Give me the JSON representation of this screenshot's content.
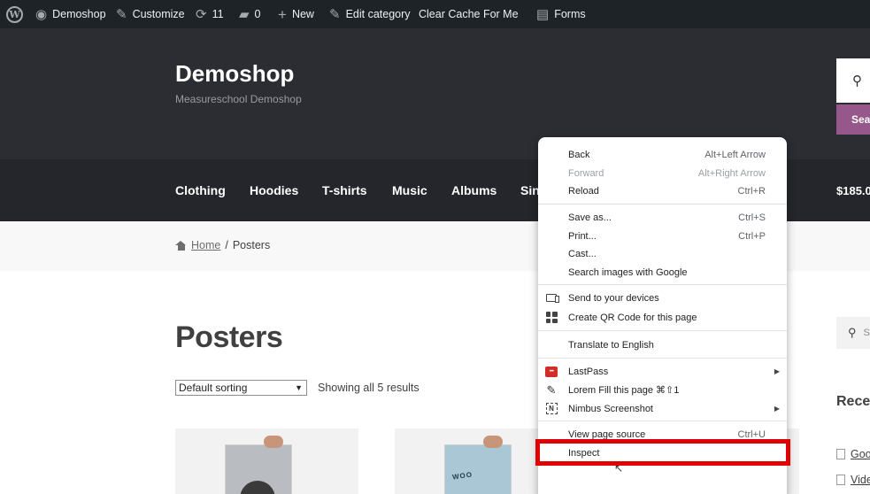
{
  "admin_bar": {
    "site_name": "Demoshop",
    "customize": "Customize",
    "updates_count": "11",
    "comments_count": "0",
    "new_label": "New",
    "edit_category": "Edit category",
    "clear_cache": "Clear Cache For Me",
    "forms": "Forms"
  },
  "header": {
    "site_title": "Demoshop",
    "site_description": "Measureschool Demoshop",
    "search_button": "Sear"
  },
  "nav": {
    "items": [
      "Clothing",
      "Hoodies",
      "T-shirts",
      "Music",
      "Albums",
      "Sin"
    ],
    "cart_total": "$185.0"
  },
  "breadcrumb": {
    "home": "Home",
    "separator": "/",
    "current": "Posters"
  },
  "main": {
    "title": "Posters",
    "sorting_selected": "Default sorting",
    "result_count": "Showing all 5 results"
  },
  "sidebar": {
    "search_placeholder": "S",
    "recent_heading": "Recen",
    "recent_items": [
      "Goo",
      "Vide"
    ]
  },
  "context_menu": {
    "groups": [
      [
        {
          "label": "Back",
          "shortcut": "Alt+Left Arrow",
          "disabled": false
        },
        {
          "label": "Forward",
          "shortcut": "Alt+Right Arrow",
          "disabled": true
        },
        {
          "label": "Reload",
          "shortcut": "Ctrl+R",
          "disabled": false
        }
      ],
      [
        {
          "label": "Save as...",
          "shortcut": "Ctrl+S",
          "disabled": false
        },
        {
          "label": "Print...",
          "shortcut": "Ctrl+P",
          "disabled": false
        },
        {
          "label": "Cast...",
          "shortcut": "",
          "disabled": false
        },
        {
          "label": "Search images with Google",
          "shortcut": "",
          "disabled": false
        }
      ],
      [
        {
          "label": "Send to your devices",
          "icon": "devices-icon"
        },
        {
          "label": "Create QR Code for this page",
          "icon": "qr-code-icon"
        }
      ],
      [
        {
          "label": "Translate to English"
        }
      ],
      [
        {
          "label": "LastPass",
          "icon": "lastpass-icon",
          "submenu": true
        },
        {
          "label": "Lorem Fill this page ⌘⇧1",
          "icon": "pen-icon"
        },
        {
          "label": "Nimbus Screenshot",
          "icon": "nimbus-icon",
          "submenu": true
        }
      ],
      [
        {
          "label": "View page source",
          "shortcut": "Ctrl+U"
        },
        {
          "label": "Inspect",
          "shortcut": ""
        }
      ]
    ]
  },
  "colors": {
    "admin_bar": "#1d2327",
    "header": "#2c2d33",
    "nav": "#25262b",
    "accent": "#96588a",
    "highlight": "#e00000"
  }
}
